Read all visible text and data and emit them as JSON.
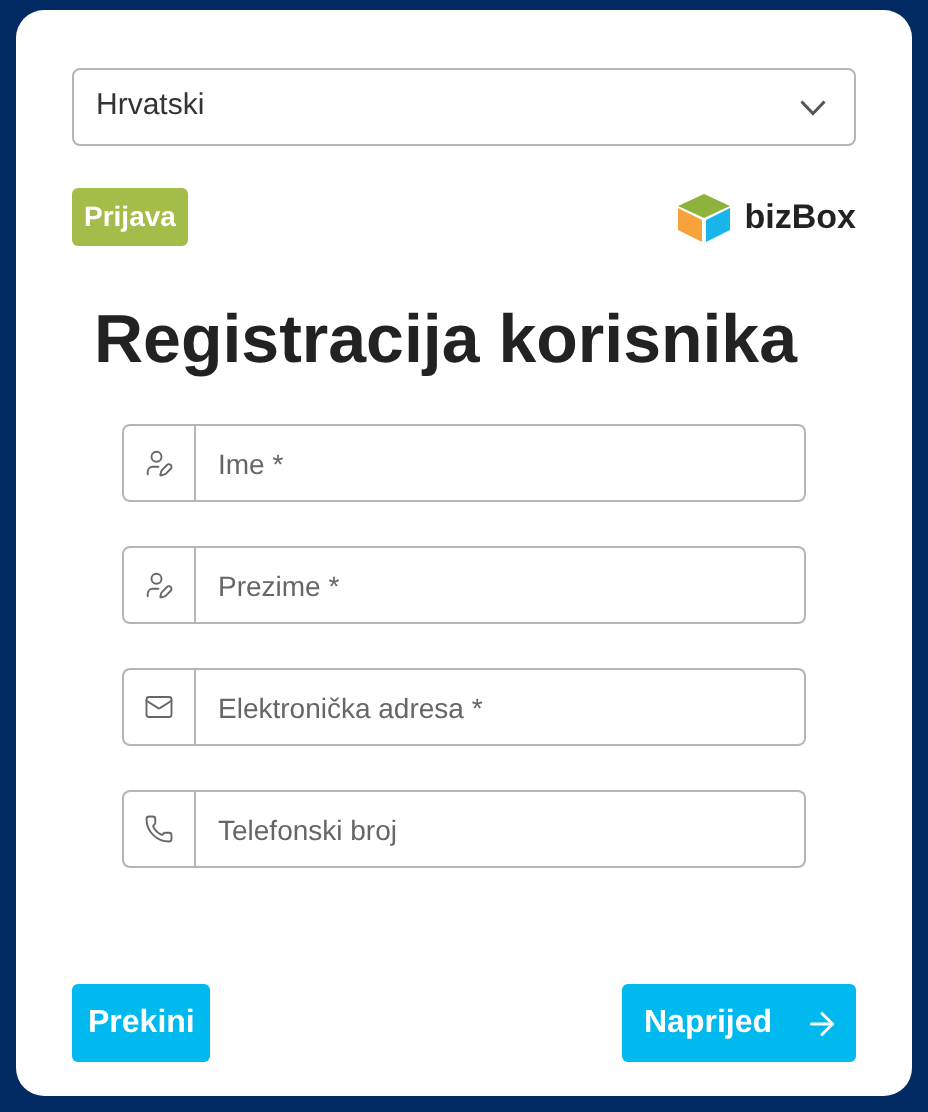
{
  "language_select": {
    "value": "Hrvatski"
  },
  "badge": "Prijava",
  "logo": {
    "text": "bizBox"
  },
  "title": "Registracija korisnika",
  "fields": [
    {
      "kind": "person",
      "placeholder": "Ime *"
    },
    {
      "kind": "person",
      "placeholder": "Prezime *"
    },
    {
      "kind": "mail",
      "placeholder": "Elektronička adresa *"
    },
    {
      "kind": "phone",
      "placeholder": "Telefonski broj"
    }
  ],
  "buttons": {
    "cancel": "Prekini",
    "next": "Naprijed"
  }
}
